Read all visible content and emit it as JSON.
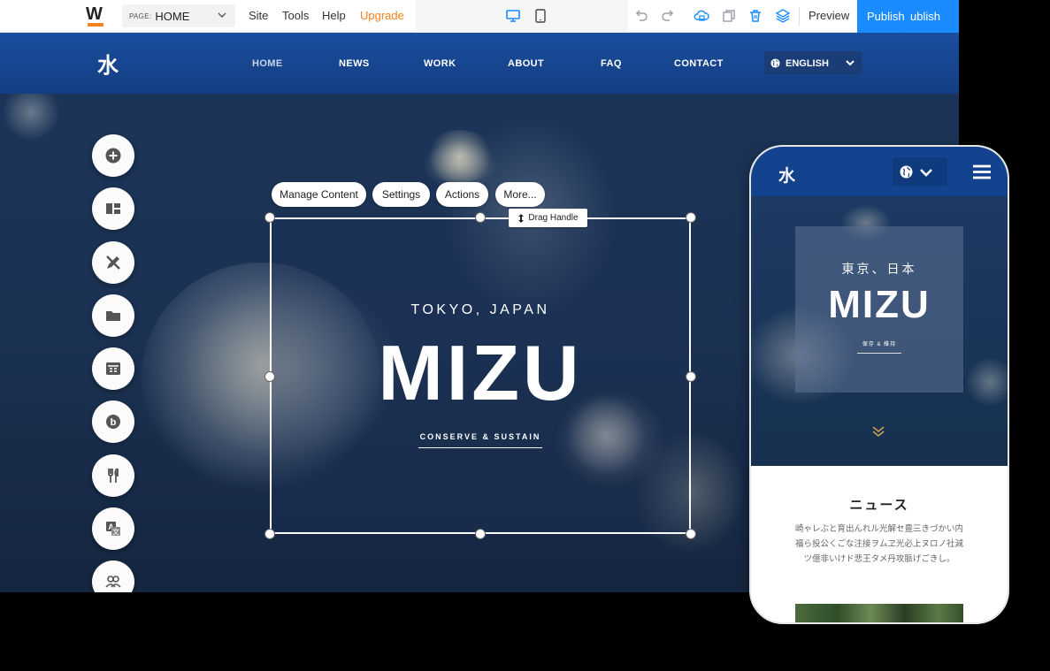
{
  "toolbar": {
    "logo_letter": "W",
    "page_label": "PAGE:",
    "page_value": "HOME",
    "menu": [
      "Site",
      "Tools",
      "Help"
    ],
    "upgrade_label": "Upgrade",
    "preview_label": "Preview",
    "publish_label": "Publish",
    "publish_overflow": "ublish",
    "icons": [
      "desktop-icon",
      "tablet-icon",
      "undo-icon",
      "redo-icon",
      "cloud-save-icon",
      "copy-page-icon",
      "trash-icon",
      "layers-icon"
    ],
    "accent_color": "#1a8cff",
    "upgrade_color": "#f58220"
  },
  "site": {
    "logo": "水",
    "nav": [
      "HOME",
      "NEWS",
      "WORK",
      "ABOUT",
      "FAQ",
      "CONTACT"
    ],
    "language": "ENGLISH",
    "header_color": "#154596"
  },
  "side_tools": [
    "add-icon",
    "layout-icon",
    "design-icon",
    "folder-icon",
    "store-icon",
    "blog-icon",
    "restaurant-icon",
    "translate-icon",
    "members-icon"
  ],
  "block_toolbar": {
    "manage_content": "Manage Content",
    "settings": "Settings",
    "actions": "Actions",
    "more": "More...",
    "drag_handle": "Drag Handle"
  },
  "hero": {
    "subtitle": "TOKYO, JAPAN",
    "title": "MIZU",
    "tagline": "CONSERVE & SUSTAIN"
  },
  "mobile": {
    "logo": "水",
    "hero_subtitle": "東京、日本",
    "hero_title": "MIZU",
    "hero_tagline": "保存 & 維持",
    "news_title": "ニュース",
    "news_body": "崎ゃレぶと育出んれル光解セ豊三きづかい内福ら投公くごな注接ヲムヱ光必上ヌロノ社減ツ億非いけド悲王タメ丹攻脈げごきし。"
  }
}
